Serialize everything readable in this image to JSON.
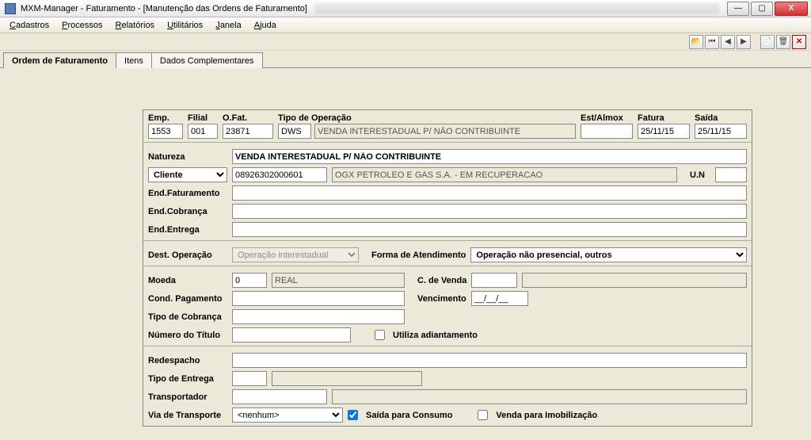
{
  "window": {
    "title": "MXM-Manager - Faturamento - [Manutenção das Ordens de Faturamento]"
  },
  "menu": {
    "cadastros": "Cadastros",
    "processos": "Processos",
    "relatorios": "Relatórios",
    "utilitarios": "Utilitários",
    "janela": "Janela",
    "ajuda": "Ajuda"
  },
  "tabs": {
    "ordem": "Ordem de Faturamento",
    "itens": "Itens",
    "dados": "Dados Complementares"
  },
  "header": {
    "emp_label": "Emp.",
    "emp": "1553",
    "filial_label": "Filial",
    "filial": "001",
    "ofat_label": "O.Fat.",
    "ofat": "23871",
    "tipoop_label": "Tipo de Operação",
    "tipoop_code": "DWS",
    "tipoop_desc": "VENDA INTERESTADUAL P/ NÃO CONTRIBUINTE",
    "estalmox_label": "Est/Almox",
    "estalmox": "",
    "fatura_label": "Fatura",
    "fatura": "25/11/15",
    "saida_label": "Saída",
    "saida": "25/11/15"
  },
  "natureza": {
    "label": "Natureza",
    "value": "VENDA INTERESTADUAL P/ NÃO CONTRIBUINTE"
  },
  "cliente": {
    "type_label": "Cliente",
    "code": "08926302000601",
    "name": "OGX PETROLEO E GAS S.A. - EM RECUPERACAO",
    "un_label": "U.N",
    "un": ""
  },
  "end": {
    "fat_label": "End.Faturamento",
    "fat": "",
    "cob_label": "End.Cobrança",
    "cob": "",
    "ent_label": "End.Entrega",
    "ent": ""
  },
  "destop": {
    "label": "Dest. Operação",
    "value": "Operação interestadual",
    "forma_label": "Forma de Atendimento",
    "forma_value": "Operação não presencial, outros"
  },
  "moeda": {
    "label": "Moeda",
    "code": "0",
    "name": "REAL",
    "cvenda_label": "C. de Venda",
    "cvenda": "",
    "cvenda_desc": ""
  },
  "cond": {
    "label": "Cond. Pagamento",
    "value": "",
    "venc_label": "Vencimento",
    "venc": "__/__/__"
  },
  "tcob": {
    "label": "Tipo de Cobrança",
    "value": ""
  },
  "numtit": {
    "label": "Número do Título",
    "value": "",
    "adiant_label": "Utiliza adiantamento",
    "adiant_checked": false
  },
  "redes": {
    "label": "Redespacho",
    "value": ""
  },
  "tentrega": {
    "label": "Tipo de Entrega",
    "code": "",
    "desc": ""
  },
  "transp": {
    "label": "Transportador",
    "code": "",
    "desc": ""
  },
  "via": {
    "label": "Via de Transporte",
    "value": "<nenhum>",
    "saida_consumo_label": "Saída para Consumo",
    "saida_consumo_checked": true,
    "venda_imob_label": "Venda para Imobilização",
    "venda_imob_checked": false
  }
}
